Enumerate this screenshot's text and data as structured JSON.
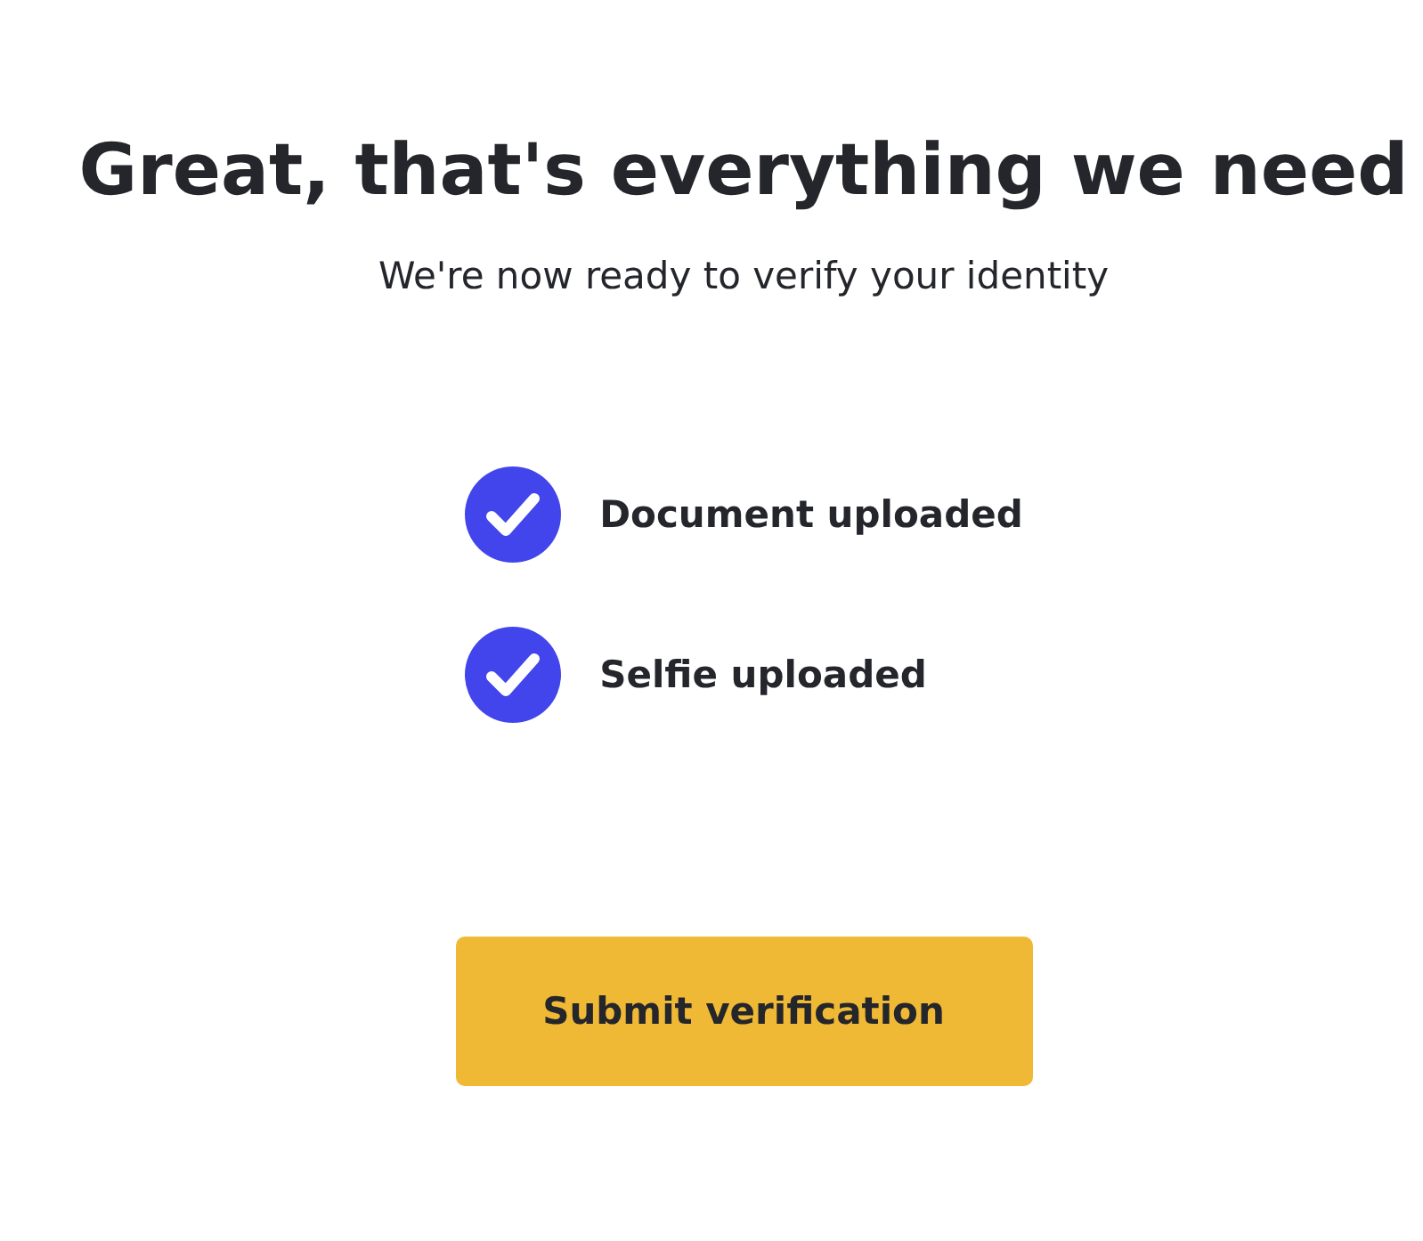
{
  "title": "Great, that's everything we need",
  "subtitle": "We're now ready to verify your identity",
  "items": [
    {
      "label": "Document uploaded",
      "checked": true
    },
    {
      "label": "Selfie uploaded",
      "checked": true
    }
  ],
  "button": {
    "label": "Submit verification"
  }
}
